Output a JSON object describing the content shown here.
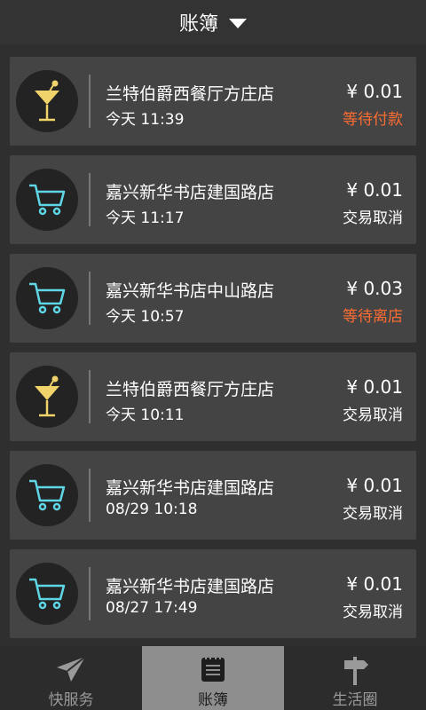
{
  "header": {
    "title": "账簿"
  },
  "transactions": [
    {
      "icon": "cocktail-icon",
      "merchant": "兰特伯爵西餐厅方庄店",
      "time": "今天  11:39",
      "amount": "¥ 0.01",
      "status": "等待付款",
      "status_type": "pending"
    },
    {
      "icon": "cart-icon",
      "merchant": "嘉兴新华书店建国路店",
      "time": "今天  11:17",
      "amount": "¥ 0.01",
      "status": "交易取消",
      "status_type": "cancelled"
    },
    {
      "icon": "cart-icon",
      "merchant": "嘉兴新华书店中山路店",
      "time": "今天  10:57",
      "amount": "¥ 0.03",
      "status": "等待离店",
      "status_type": "pending"
    },
    {
      "icon": "cocktail-icon",
      "merchant": "兰特伯爵西餐厅方庄店",
      "time": "今天  10:11",
      "amount": "¥ 0.01",
      "status": "交易取消",
      "status_type": "cancelled"
    },
    {
      "icon": "cart-icon",
      "merchant": "嘉兴新华书店建国路店",
      "time": "08/29 10:18",
      "amount": "¥ 0.01",
      "status": "交易取消",
      "status_type": "cancelled"
    },
    {
      "icon": "cart-icon",
      "merchant": "嘉兴新华书店建国路店",
      "time": "08/27 17:49",
      "amount": "¥ 0.01",
      "status": "交易取消",
      "status_type": "cancelled"
    }
  ],
  "tabs": [
    {
      "label": "快服务",
      "icon": "paper-plane-icon",
      "active": false
    },
    {
      "label": "账簿",
      "icon": "ledger-icon",
      "active": true
    },
    {
      "label": "生活圈",
      "icon": "signpost-icon",
      "active": false
    }
  ],
  "colors": {
    "pending": "#ff6d32",
    "cart": "#5fd6e6",
    "cocktail": "#f0d36a",
    "active_tab": "#8e8e8e"
  }
}
